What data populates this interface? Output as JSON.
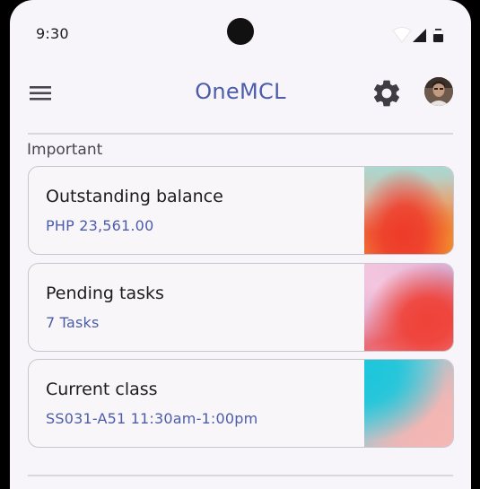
{
  "status_bar": {
    "time": "9:30",
    "icons": [
      "wifi-icon",
      "signal-icon",
      "battery-icon"
    ]
  },
  "app_bar": {
    "title": "OneMCL",
    "menu_icon": "hamburger-menu-icon",
    "settings_icon": "gear-icon",
    "avatar": "user-avatar"
  },
  "section": {
    "label": "Important"
  },
  "cards": [
    {
      "title": "Outstanding balance",
      "subtitle": "PHP 23,561.00"
    },
    {
      "title": "Pending tasks",
      "subtitle": "7 Tasks"
    },
    {
      "title": "Current class",
      "subtitle": "SS031-A51 11:30am-1:00pm"
    }
  ],
  "colors": {
    "accent": "#4b5da9",
    "background": "#f8f5fa",
    "text": "#1c1b1f",
    "border": "#c9c5cc"
  }
}
